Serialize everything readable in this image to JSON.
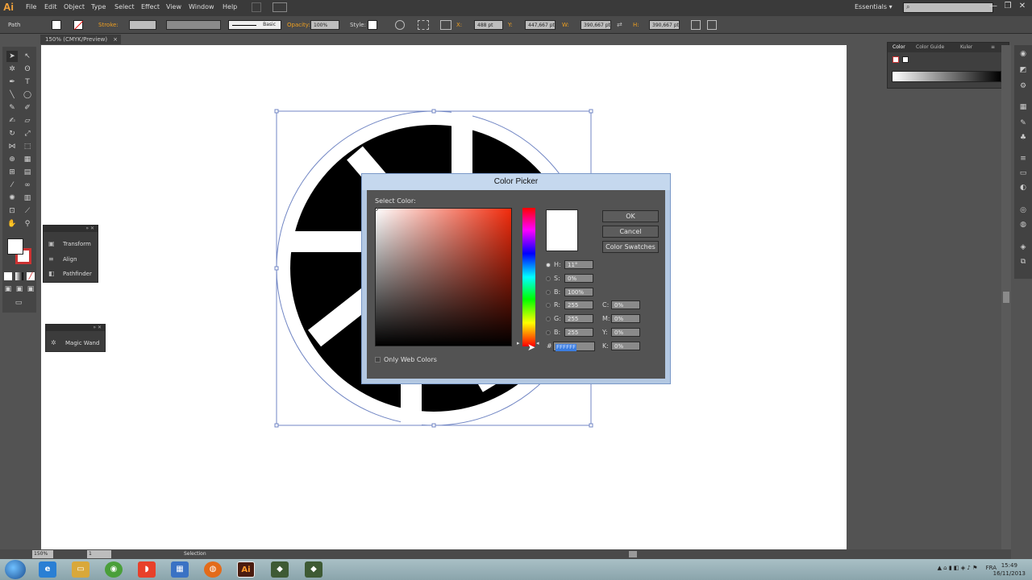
{
  "app": {
    "logo": "Ai"
  },
  "menu": [
    "File",
    "Edit",
    "Object",
    "Type",
    "Select",
    "Effect",
    "View",
    "Window",
    "Help"
  ],
  "workspace": {
    "label": "Essentials",
    "arrow": "▾"
  },
  "control": {
    "selection_type": "Path",
    "stroke_label": "Stroke:",
    "brush_label": "Basic",
    "opacity_label": "Opacity:",
    "opacity_value": "100%",
    "style_label": "Style:",
    "x_label": "X:",
    "x_value": "488 pt",
    "y_label": "Y:",
    "y_value": "447,667 pt",
    "w_label": "W:",
    "w_value": "390,667 pt",
    "h_label": "H:",
    "h_value": "390,667 pt"
  },
  "document_tab": {
    "title": "150% (CMYK/Preview)",
    "close": "×"
  },
  "panels": {
    "transform_group": [
      "Transform",
      "Align",
      "Pathfinder"
    ],
    "magic_wand": "Magic Wand",
    "color_tabs": [
      "Color",
      "Color Guide",
      "Kuler"
    ]
  },
  "status": {
    "zoom": "150%",
    "page": "1",
    "tool": "Selection"
  },
  "color_picker": {
    "title": "Color Picker",
    "select_label": "Select Color:",
    "ok": "OK",
    "cancel": "Cancel",
    "swatches": "Color Swatches",
    "hsb": [
      {
        "label": "H:",
        "value": "11°"
      },
      {
        "label": "S:",
        "value": "0%"
      },
      {
        "label": "B:",
        "value": "100%"
      }
    ],
    "rgb": [
      {
        "label": "R:",
        "value": "255"
      },
      {
        "label": "G:",
        "value": "255"
      },
      {
        "label": "B:",
        "value": "255"
      }
    ],
    "cmyk": [
      {
        "label": "C:",
        "value": "0%"
      },
      {
        "label": "M:",
        "value": "0%"
      },
      {
        "label": "Y:",
        "value": "0%"
      },
      {
        "label": "K:",
        "value": "0%"
      }
    ],
    "hex_label": "#",
    "hex_value": "FFFFFF",
    "web_colors": "Only Web Colors",
    "preview_color": "#ffffff",
    "hue_color": "#f22b0c"
  },
  "taskbar": {
    "lang": "FRA",
    "time": "15:49",
    "date": "16/11/2013",
    "illustrator_label": "Ai"
  }
}
